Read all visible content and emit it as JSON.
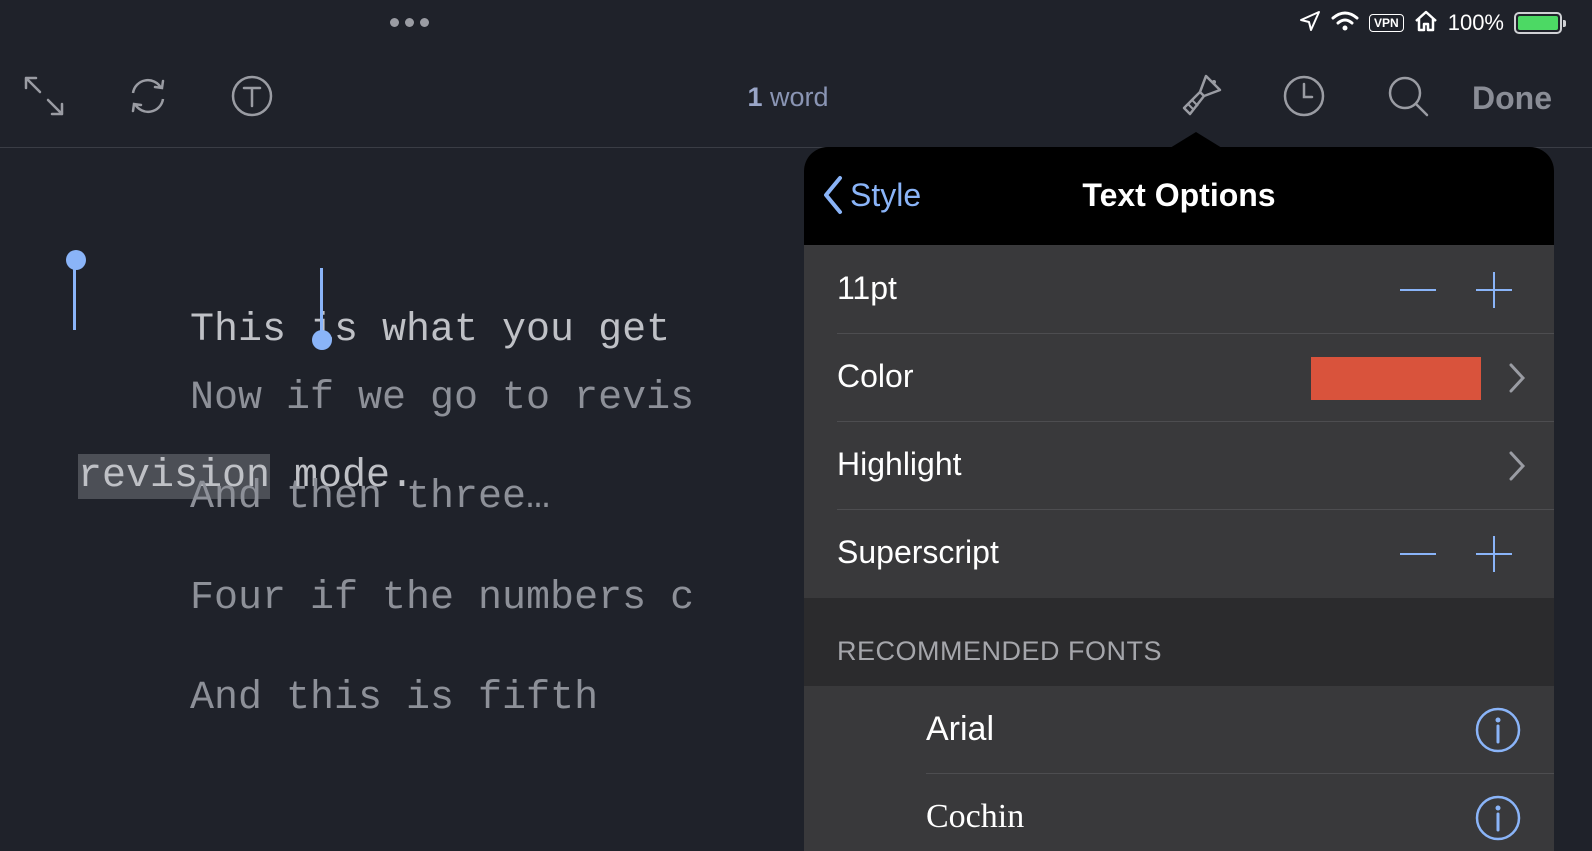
{
  "status": {
    "vpn_label": "VPN",
    "battery_percent": "100%",
    "icons": [
      "location-arrow-icon",
      "wifi-icon",
      "vpn-badge",
      "home-icon",
      "battery-charging-icon"
    ]
  },
  "toolbar": {
    "word_count_number": "1",
    "word_count_unit": "word",
    "done_label": "Done",
    "icons": [
      "expand-icon",
      "sync-icon",
      "typewriter-icon",
      "brush-icon",
      "history-clock-icon",
      "search-icon"
    ]
  },
  "editor": {
    "line1_visible": "This is what you get",
    "line2_selected": "revision",
    "line2_rest": " mode.",
    "paragraphs": [
      "Now if we go to revis",
      "And then three…",
      "Four if the numbers c",
      "And this is fifth"
    ],
    "indent": "    "
  },
  "popover": {
    "back_label": "Style",
    "title": "Text Options",
    "size_label": "11pt",
    "color_label": "Color",
    "color_value": "#d9533c",
    "highlight_label": "Highlight",
    "superscript_label": "Superscript",
    "section_label": "RECOMMENDED FONTS",
    "fonts": [
      "Arial",
      "Cochin"
    ]
  }
}
